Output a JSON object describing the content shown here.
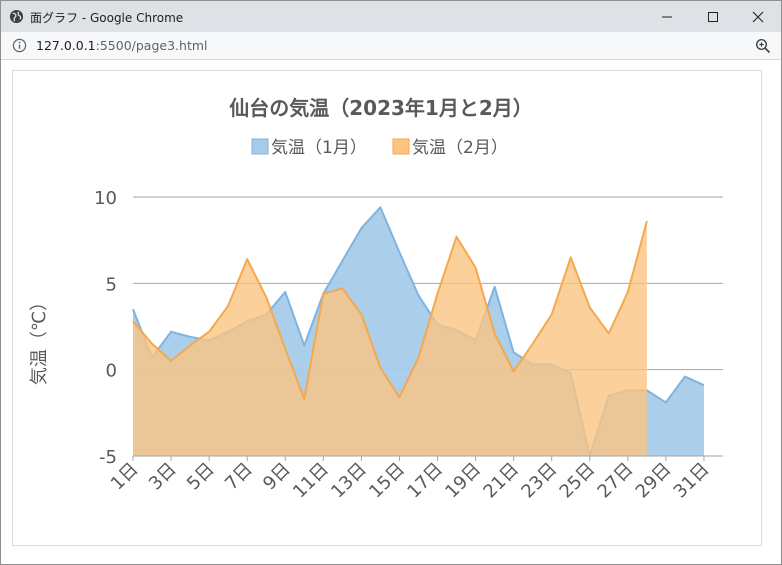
{
  "window": {
    "title": "面グラフ - Google Chrome",
    "url_host": "127.0.0.1",
    "url_path": ":5500/page3.html"
  },
  "icons": {
    "app": "globe-icon",
    "info": "info-icon",
    "zoom": "zoom-in-icon",
    "minimize": "minimize-icon",
    "maximize": "maximize-icon",
    "close": "close-icon"
  },
  "colors": {
    "jan_fill": "#a6cbe9",
    "jan_line": "#7fb4e0",
    "feb_fill": "#fbc482",
    "feb_line": "#f5a84e",
    "overlap_fill": "#e0b985",
    "grid": "#a6a6a6",
    "text": "#595959"
  },
  "chart_data": {
    "type": "area",
    "title": "仙台の気温（2023年1月と2月）",
    "ylabel": "気温（℃）",
    "xlabel": "",
    "ylim": [
      -5,
      10
    ],
    "yticks": [
      "10",
      "5",
      "0",
      "-5"
    ],
    "grid": true,
    "legend_position": "top",
    "x_tick_labels": [
      "1日",
      "3日",
      "5日",
      "7日",
      "9日",
      "11日",
      "13日",
      "15日",
      "17日",
      "19日",
      "21日",
      "23日",
      "25日",
      "27日",
      "29日",
      "31日"
    ],
    "series": [
      {
        "name": "気温（1月）",
        "days": [
          1,
          2,
          3,
          4,
          5,
          6,
          7,
          8,
          9,
          10,
          11,
          12,
          13,
          14,
          15,
          16,
          17,
          18,
          19,
          20,
          21,
          22,
          23,
          24,
          25,
          26,
          27,
          28,
          29,
          30,
          31
        ],
        "values": [
          3.5,
          0.7,
          2.2,
          1.9,
          1.7,
          2.2,
          2.8,
          3.2,
          4.5,
          1.4,
          4.4,
          6.3,
          8.2,
          9.4,
          6.8,
          4.3,
          2.6,
          2.3,
          1.7,
          4.8,
          1.0,
          0.3,
          0.3,
          -0.2,
          -5.0,
          -1.5,
          -1.2,
          -1.2,
          -1.9,
          -0.4,
          -0.9
        ]
      },
      {
        "name": "気温（2月）",
        "days": [
          1,
          2,
          3,
          4,
          5,
          6,
          7,
          8,
          9,
          10,
          11,
          12,
          13,
          14,
          15,
          16,
          17,
          18,
          19,
          20,
          21,
          22,
          23,
          24,
          25,
          26,
          27,
          28
        ],
        "values": [
          2.8,
          1.5,
          0.5,
          1.4,
          2.2,
          3.7,
          6.4,
          4.2,
          1.2,
          -1.7,
          4.4,
          4.7,
          3.2,
          0.1,
          -1.6,
          0.7,
          4.4,
          7.7,
          5.9,
          2.1,
          -0.1,
          1.5,
          3.2,
          6.5,
          3.6,
          2.1,
          4.5,
          8.6
        ]
      }
    ]
  }
}
